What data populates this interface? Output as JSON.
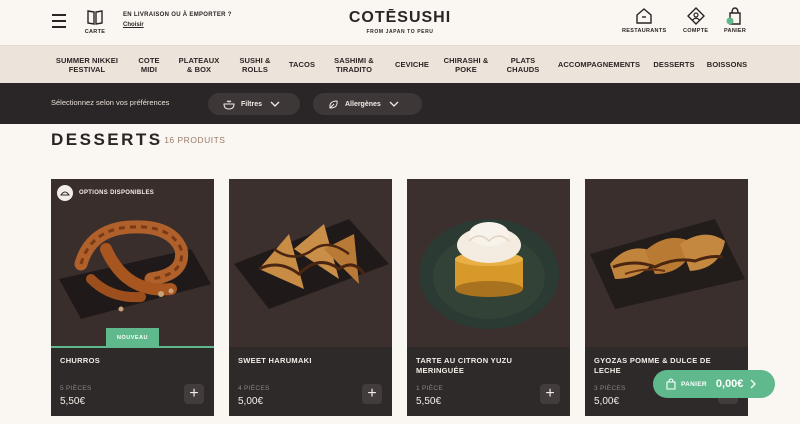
{
  "header": {
    "carte_label": "CARTE",
    "delivery_question": "EN LIVRAISON OU À EMPORTER ?",
    "delivery_choose": "Choisir",
    "logo_name": "COTĒSUSHI",
    "logo_tagline": "FROM JAPAN TO PERU",
    "restaurants_label": "RESTAURANTS",
    "account_label": "COMPTE",
    "cart_label": "PANIER"
  },
  "nav": {
    "items": [
      {
        "line1": "SUMMER NIKKEI",
        "line2": "FESTIVAL"
      },
      {
        "line1": "COTE",
        "line2": "MIDI"
      },
      {
        "line1": "PLATEAUX",
        "line2": "& BOX"
      },
      {
        "line1": "SUSHI &",
        "line2": "ROLLS"
      },
      {
        "line1": "TACOS",
        "line2": ""
      },
      {
        "line1": "SASHIMI &",
        "line2": "TIRADITO"
      },
      {
        "line1": "CEVICHE",
        "line2": ""
      },
      {
        "line1": "CHIRASHI &",
        "line2": "POKE"
      },
      {
        "line1": "PLATS",
        "line2": "CHAUDS"
      },
      {
        "line1": "ACCOMPAGNEMENTS",
        "line2": ""
      },
      {
        "line1": "DESSERTS",
        "line2": ""
      },
      {
        "line1": "BOISSONS",
        "line2": ""
      }
    ]
  },
  "filters": {
    "prompt": "Sélectionnez selon vos préférences",
    "filters_label": "Filtres",
    "allergens_label": "Allergènes"
  },
  "section": {
    "title": "DESSERTS",
    "count": "- 16 PRODUITS"
  },
  "products": [
    {
      "title": "CHURROS",
      "pieces": "5 PIÈCES",
      "price": "5,50€",
      "badge_options": "OPTIONS DISPONIBLES",
      "badge_new": "NOUVEAU"
    },
    {
      "title": "SWEET HARUMAKI",
      "pieces": "4 PIÈCES",
      "price": "5,00€"
    },
    {
      "title": "TARTE AU CITRON YUZU MERINGUÉE",
      "pieces": "1 PIÈCE",
      "price": "5,50€"
    },
    {
      "title": "GYOZAS POMME & DULCE DE LECHE",
      "pieces": "3 PIÈCES",
      "price": "5,00€"
    }
  ],
  "cart": {
    "label": "PANIER",
    "amount": "0,00€"
  },
  "colors": {
    "accent_green": "#5fb98c",
    "dark_bar": "#2a2526",
    "nav_bg": "#ece3da",
    "page_bg": "#faf6f1",
    "card_bg": "#2f2a2a"
  }
}
